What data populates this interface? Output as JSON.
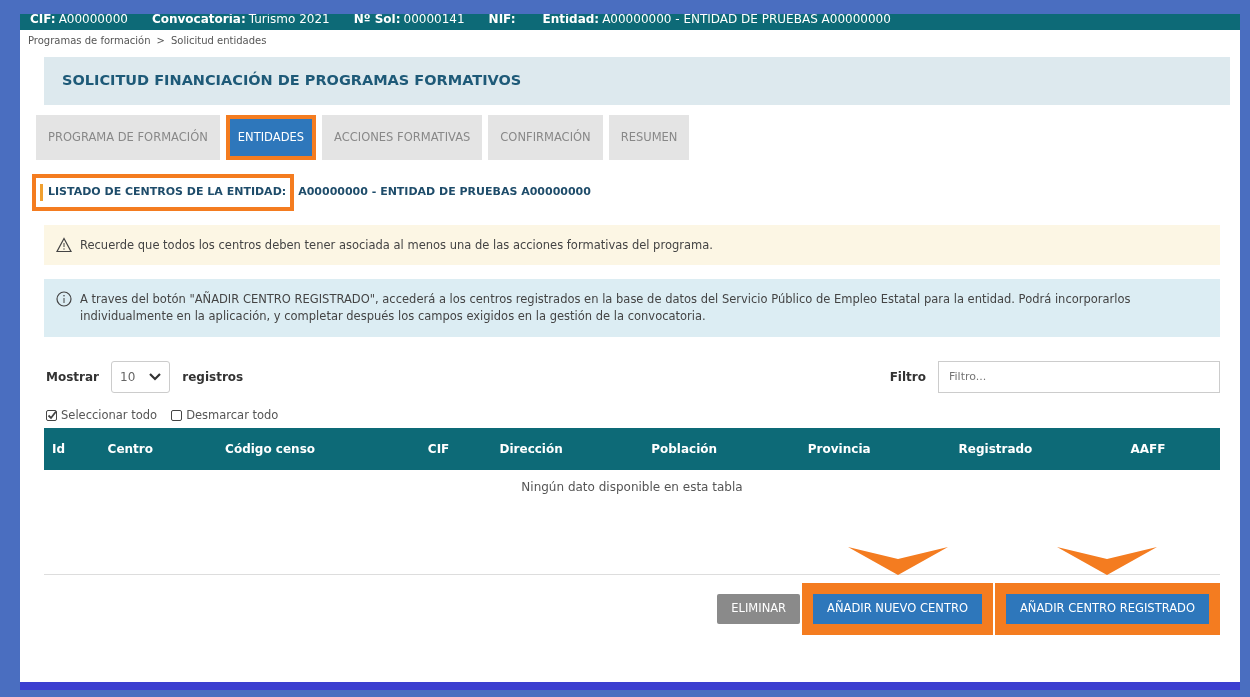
{
  "header_bar": [
    {
      "label": "CIF:",
      "value": "A00000000"
    },
    {
      "label": "Convocatoria:",
      "value": "Turismo 2021"
    },
    {
      "label": "Nº Sol:",
      "value": "00000141"
    },
    {
      "label": "NIF:"
    },
    {
      "label": "Entidad:",
      "value": "A00000000 - ENTIDAD DE PRUEBAS A00000000"
    }
  ],
  "breadcrumb": {
    "items": [
      "Programas de formación",
      "Solicitud entidades"
    ],
    "separator": ">"
  },
  "title": "SOLICITUD FINANCIACIÓN DE PROGRAMAS FORMATIVOS",
  "tabs": [
    {
      "label": "PROGRAMA DE FORMACIÓN",
      "selected": false,
      "highlighted": false
    },
    {
      "label": "ENTIDADES",
      "selected": true,
      "highlighted": true
    },
    {
      "label": "ACCIONES FORMATIVAS",
      "selected": false,
      "highlighted": false
    },
    {
      "label": "CONFIRMACIÓN",
      "selected": false,
      "highlighted": false
    },
    {
      "label": "RESUMEN",
      "selected": false,
      "highlighted": false
    }
  ],
  "section_heading": {
    "label": "LISTADO DE CENTROS DE LA ENTIDAD:",
    "value": "A00000000 - ENTIDAD DE PRUEBAS A00000000",
    "highlighted": true
  },
  "alerts": [
    {
      "kind": "warning",
      "text": "Recuerde que todos los centros deben tener asociada al menos una de las acciones formativas del programa."
    },
    {
      "kind": "info",
      "text": "A traves del botón \"AÑADIR CENTRO REGISTRADO\", accederá a los centros registrados en la base de datos del Servicio Público de Empleo Estatal para la entidad. Podrá incorporarlos individualmente en la aplicación, y completar después los campos exigidos en la gestión de la convocatoria."
    }
  ],
  "page_length": {
    "label": "Mostrar",
    "value": "10",
    "suffix": "registros"
  },
  "filter": {
    "label": "Filtro",
    "placeholder": "Filtro..."
  },
  "select_links": [
    {
      "label": "Seleccionar todo",
      "checked": true
    },
    {
      "label": "Desmarcar todo",
      "checked": false
    }
  ],
  "table": {
    "columns": [
      "Id",
      "Centro",
      "Código censo",
      "CIF",
      "Dirección",
      "Población",
      "Provincia",
      "Registrado",
      "AAFF"
    ],
    "empty_message": "Ningún dato disponible en esta tabla"
  },
  "buttons": [
    {
      "label": "ELIMINAR",
      "kind": "secondary",
      "highlighted": false
    },
    {
      "label": "AÑADIR NUEVO CENTRO",
      "kind": "primary",
      "highlighted": true
    },
    {
      "label": "AÑADIR CENTRO REGISTRADO",
      "kind": "primary",
      "highlighted": true
    }
  ]
}
